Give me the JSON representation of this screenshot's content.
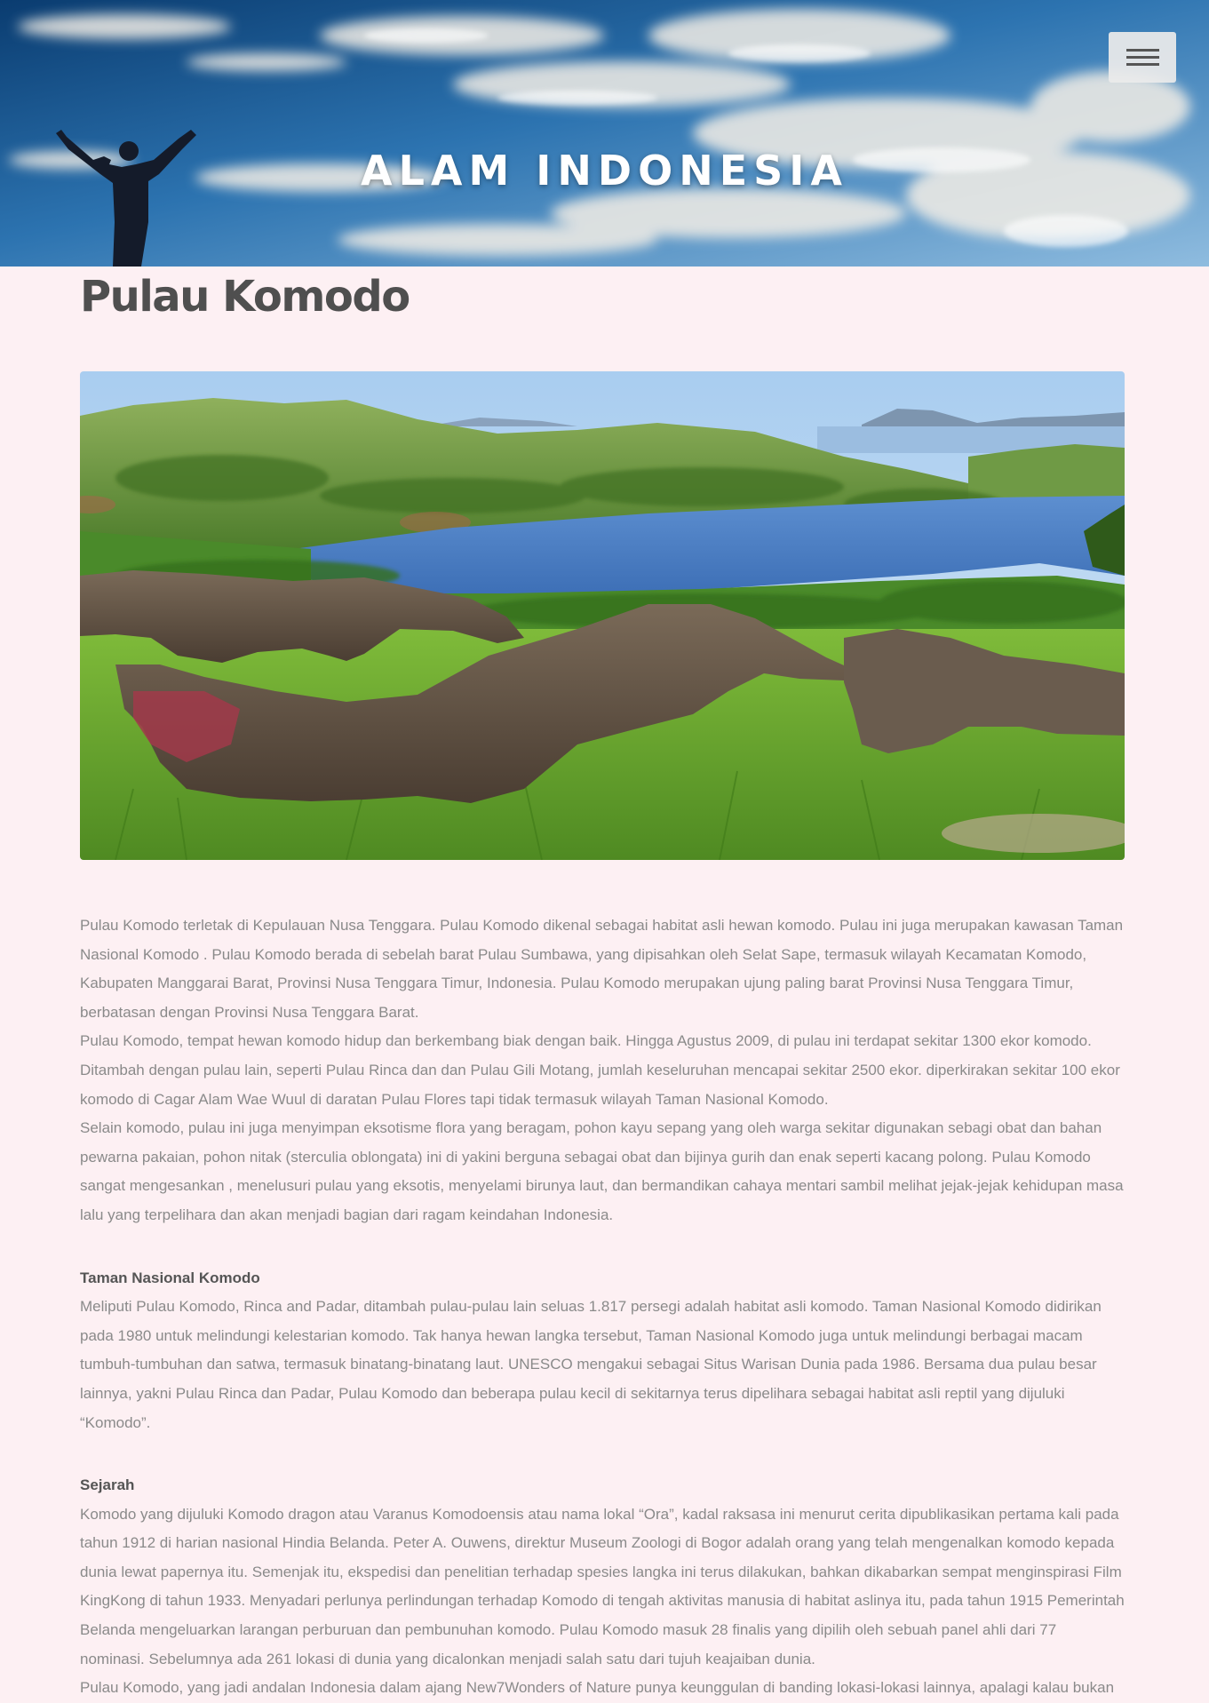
{
  "header": {
    "site_title": "ALAM INDONESIA",
    "menu_icon": "hamburger-menu-icon"
  },
  "article": {
    "title": "Pulau Komodo",
    "image_alt": "Pulau Komodo",
    "paragraphs": [
      "Pulau Komodo terletak di Kepulauan Nusa Tenggara. Pulau Komodo dikenal sebagai habitat asli hewan komodo. Pulau ini juga merupakan kawasan Taman Nasional Komodo . Pulau Komodo berada di sebelah barat Pulau Sumbawa, yang dipisahkan oleh Selat Sape, termasuk wilayah Kecamatan Komodo, Kabupaten Manggarai Barat, Provinsi Nusa Tenggara Timur, Indonesia. Pulau Komodo merupakan ujung paling barat Provinsi Nusa Tenggara Timur, berbatasan dengan Provinsi Nusa Tenggara Barat.",
      "Pulau Komodo, tempat hewan komodo hidup dan berkembang biak dengan baik. Hingga Agustus 2009, di pulau ini terdapat sekitar 1300 ekor komodo. Ditambah dengan pulau lain, seperti Pulau Rinca dan dan Pulau Gili Motang, jumlah keseluruhan mencapai sekitar 2500 ekor. diperkirakan sekitar 100 ekor komodo di Cagar Alam Wae Wuul di daratan Pulau Flores tapi tidak termasuk wilayah Taman Nasional Komodo.",
      "Selain komodo, pulau ini juga menyimpan eksotisme flora yang beragam, pohon kayu sepang yang oleh warga sekitar digunakan sebagi obat dan bahan pewarna pakaian, pohon nitak (sterculia oblongata) ini di yakini berguna sebagai obat dan bijinya gurih dan enak seperti kacang polong. Pulau Komodo sangat mengesankan , menelusuri pulau yang eksotis, menyelami birunya laut, dan bermandikan cahaya mentari sambil melihat jejak-jejak kehidupan masa lalu yang terpelihara dan akan menjadi bagian dari ragam keindahan Indonesia."
    ],
    "sections": [
      {
        "heading": "Taman Nasional Komodo",
        "paragraphs": [
          "Meliputi Pulau Komodo, Rinca and Padar, ditambah pulau-pulau lain seluas 1.817 persegi adalah habitat asli komodo. Taman Nasional Komodo didirikan pada 1980 untuk melindungi kelestarian komodo. Tak hanya hewan langka tersebut, Taman Nasional Komodo juga untuk melindungi berbagai macam tumbuh-tumbuhan dan satwa, termasuk binatang-binatang laut. UNESCO mengakui sebagai Situs Warisan Dunia pada 1986. Bersama dua pulau besar lainnya, yakni Pulau Rinca dan Padar, Pulau Komodo dan beberapa pulau kecil di sekitarnya terus dipelihara sebagai habitat asli reptil yang dijuluki “Komodo”."
        ]
      },
      {
        "heading": "Sejarah",
        "paragraphs": [
          "Komodo yang dijuluki Komodo dragon atau Varanus Komodoensis atau nama lokal “Ora”, kadal raksasa ini menurut cerita dipublikasikan pertama kali pada tahun 1912 di harian nasional Hindia Belanda. Peter A. Ouwens, direktur Museum Zoologi di Bogor adalah orang yang telah mengenalkan komodo kepada dunia lewat papernya itu. Semenjak itu, ekspedisi dan penelitian terhadap spesies langka ini terus dilakukan, bahkan dikabarkan sempat menginspirasi Film KingKong di tahun 1933. Menyadari perlunya perlindungan terhadap Komodo di tengah aktivitas manusia di habitat aslinya itu, pada tahun 1915 Pemerintah Belanda mengeluarkan larangan perburuan dan pembunuhan komodo. Pulau Komodo masuk 28 finalis yang dipilih oleh sebuah panel ahli dari 77 nominasi. Sebelumnya ada 261 lokasi di dunia yang dicalonkan menjadi salah satu dari tujuh keajaiban dunia.",
          "Pulau Komodo, yang jadi andalan Indonesia dalam ajang New7Wonders of Nature punya keunggulan di banding lokasi-lokasi lainnya, apalagi kalau bukan"
        ]
      }
    ]
  }
}
